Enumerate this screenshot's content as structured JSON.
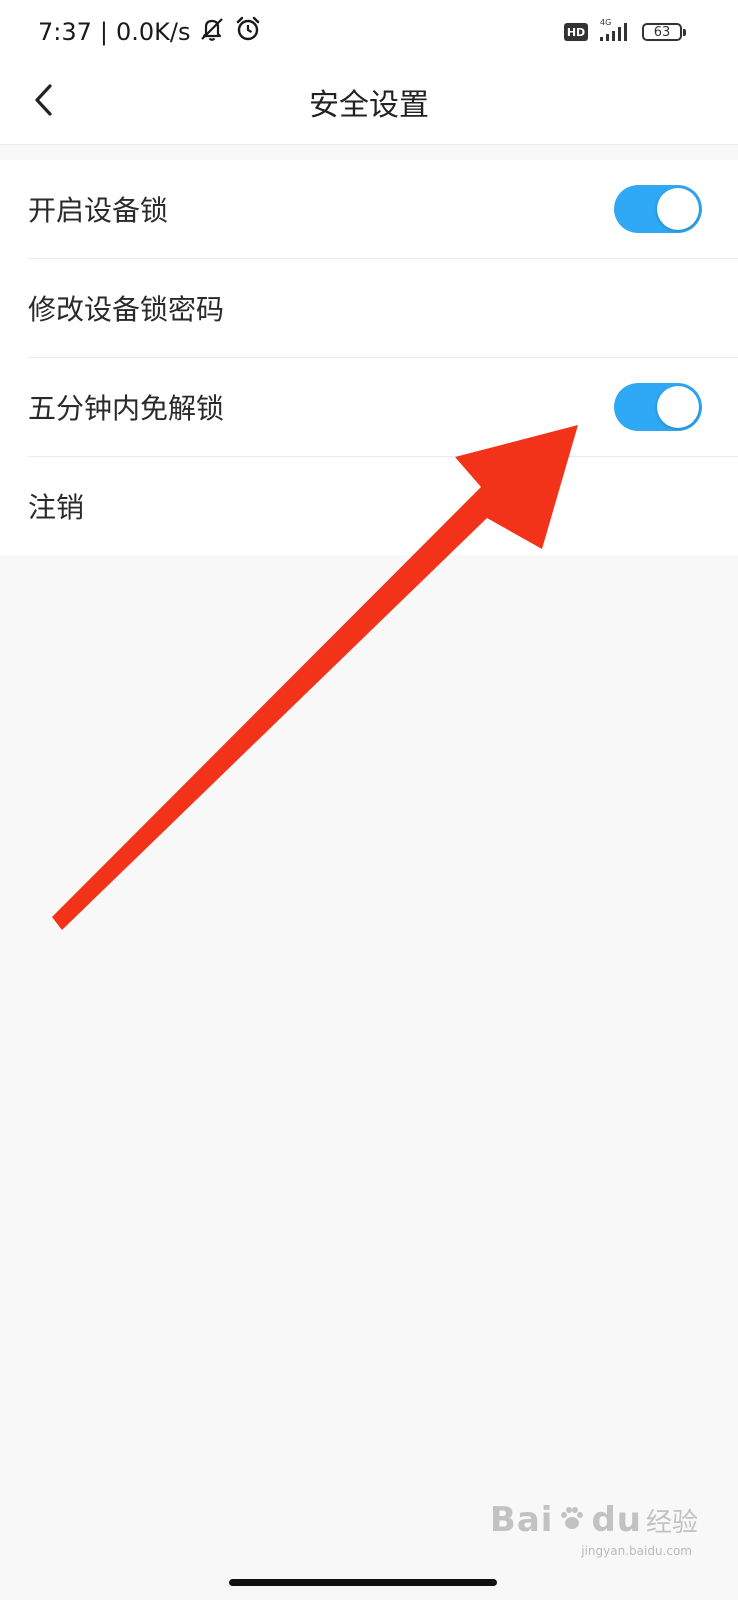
{
  "status_bar": {
    "time": "7:37",
    "separator": "|",
    "net_speed": "0.0K/s",
    "hd_label": "HD",
    "network_type": "4G",
    "battery": "63",
    "icons": [
      "mute-icon",
      "alarm-icon",
      "signal-icon",
      "battery-icon"
    ]
  },
  "header": {
    "title": "安全设置",
    "back_icon": "chevron-left-icon"
  },
  "settings": {
    "items": [
      {
        "label": "开启设备锁",
        "toggle": true,
        "on": true
      },
      {
        "label": "修改设备锁密码",
        "toggle": false
      },
      {
        "label": "五分钟内免解锁",
        "toggle": true,
        "on": true
      },
      {
        "label": "注销",
        "toggle": false
      }
    ]
  },
  "colors": {
    "toggle_on": "#2fa8f6",
    "arrow": "#f3321a",
    "background": "#f8f8f8"
  },
  "watermark": {
    "main": "Bai",
    "main2": "du",
    "cn": "经验",
    "sub": "jingyan.baidu.com"
  }
}
